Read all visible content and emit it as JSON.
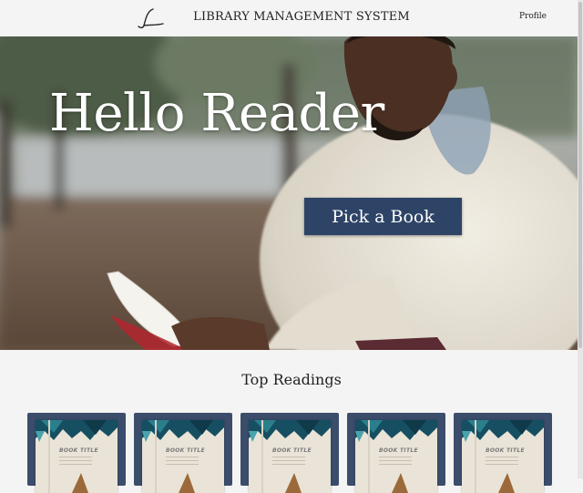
{
  "navbar": {
    "logo_letter": "L",
    "title": "LIBRARY MANAGEMENT SYSTEM",
    "profile_label": "Profile"
  },
  "hero": {
    "heading": "Hello Reader",
    "cta_label": "Pick a Book"
  },
  "top_readings": {
    "title": "Top Readings",
    "books": [
      {
        "cover_title": "BOOK TITLE"
      },
      {
        "cover_title": "BOOK TITLE"
      },
      {
        "cover_title": "BOOK TITLE"
      },
      {
        "cover_title": "BOOK TITLE"
      },
      {
        "cover_title": "BOOK TITLE"
      }
    ]
  },
  "colors": {
    "accent": "#2e4467",
    "card": "#3b4d6b",
    "page_bg": "#f4f4f4"
  }
}
